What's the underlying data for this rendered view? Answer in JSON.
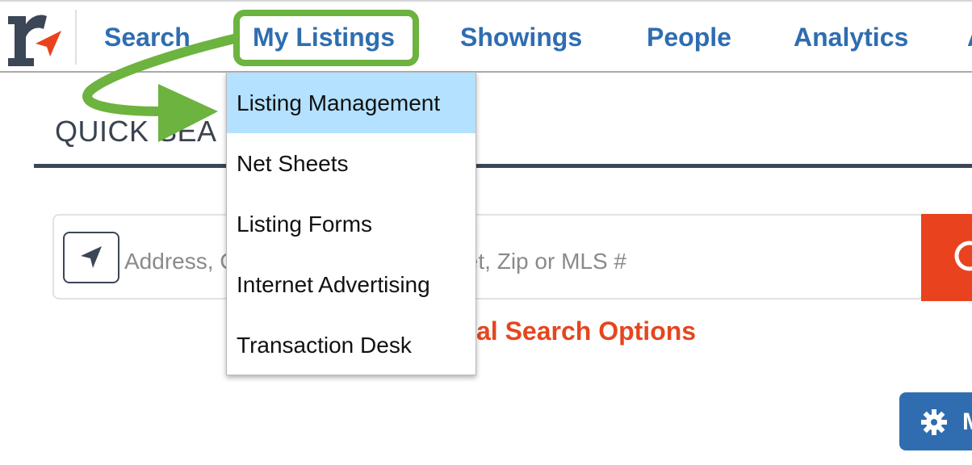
{
  "nav": {
    "items": [
      "Search",
      "My Listings",
      "Showings",
      "People",
      "Analytics",
      "A"
    ],
    "highlight_color": "#6cb33f"
  },
  "dropdown": {
    "items": [
      "Listing Management",
      "Net Sheets",
      "Listing Forms",
      "Internet Advertising",
      "Transaction Desk"
    ],
    "active_item": "Listing Management",
    "active_color": "#b3e1ff"
  },
  "quick_search": {
    "title": "QUICK SEA",
    "placeholder": "Address, City, Neighborhood, Street, Zip or MLS #",
    "visible_placeholder_start": "Address,",
    "visible_placeholder_end": "Street, Zip or MLS #",
    "additional_options": "al Search Options",
    "search_button_color": "#e8431e"
  },
  "manage_button": {
    "label": "M",
    "icon": "gear-icon"
  },
  "icons": {
    "logo": "r-logo-icon",
    "locate": "location-arrow-icon",
    "search": "magnifier-icon",
    "annotation_arrow": "green-arrow-icon"
  },
  "colors": {
    "nav_text": "#2f6db0",
    "accent_orange": "#e5461f",
    "dark": "#3b4656"
  }
}
